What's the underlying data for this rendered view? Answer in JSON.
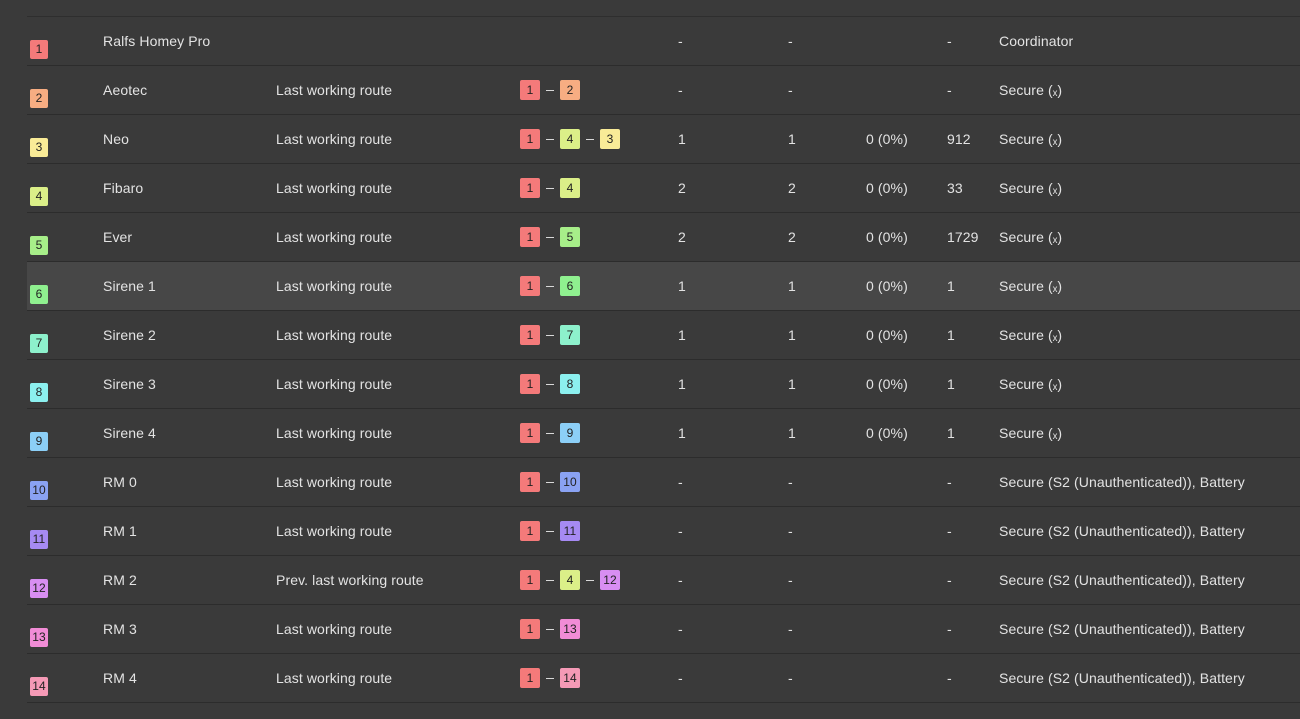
{
  "colors": {
    "1": "#f47a7a",
    "2": "#f7ad82",
    "3": "#f9eb97",
    "4": "#dbef88",
    "5": "#a7ee89",
    "6": "#8ff08f",
    "7": "#8df1cc",
    "8": "#8cf0ef",
    "9": "#8ccff7",
    "10": "#8aa2f2",
    "11": "#a68af3",
    "12": "#d88ef2",
    "13": "#f18cd6",
    "14": "#f59ab6"
  },
  "rows": [
    {
      "id": "1",
      "name": "Ralfs Homey Pro",
      "type": "",
      "route": [],
      "a": "-",
      "b": "-",
      "c": "",
      "d": "-",
      "security": "Coordinator",
      "highlight": false
    },
    {
      "id": "2",
      "name": "Aeotec",
      "type": "Last working route",
      "route": [
        "1",
        "2"
      ],
      "a": "-",
      "b": "-",
      "c": "",
      "d": "-",
      "security": "Secure (ₓ)",
      "highlight": false
    },
    {
      "id": "3",
      "name": "Neo",
      "type": "Last working route",
      "route": [
        "1",
        "4",
        "3"
      ],
      "a": "1",
      "b": "1",
      "c": "0 (0%)",
      "d": "912",
      "security": "Secure (ₓ)",
      "highlight": false
    },
    {
      "id": "4",
      "name": "Fibaro",
      "type": "Last working route",
      "route": [
        "1",
        "4"
      ],
      "a": "2",
      "b": "2",
      "c": "0 (0%)",
      "d": "33",
      "security": "Secure (ₓ)",
      "highlight": false
    },
    {
      "id": "5",
      "name": "Ever",
      "type": "Last working route",
      "route": [
        "1",
        "5"
      ],
      "a": "2",
      "b": "2",
      "c": "0 (0%)",
      "d": "1729",
      "security": "Secure (ₓ)",
      "highlight": false
    },
    {
      "id": "6",
      "name": "Sirene 1",
      "type": "Last working route",
      "route": [
        "1",
        "6"
      ],
      "a": "1",
      "b": "1",
      "c": "0 (0%)",
      "d": "1",
      "security": "Secure (ₓ)",
      "highlight": true
    },
    {
      "id": "7",
      "name": "Sirene 2",
      "type": "Last working route",
      "route": [
        "1",
        "7"
      ],
      "a": "1",
      "b": "1",
      "c": "0 (0%)",
      "d": "1",
      "security": "Secure (ₓ)",
      "highlight": false
    },
    {
      "id": "8",
      "name": "Sirene 3",
      "type": "Last working route",
      "route": [
        "1",
        "8"
      ],
      "a": "1",
      "b": "1",
      "c": "0 (0%)",
      "d": "1",
      "security": "Secure (ₓ)",
      "highlight": false
    },
    {
      "id": "9",
      "name": "Sirene 4",
      "type": "Last working route",
      "route": [
        "1",
        "9"
      ],
      "a": "1",
      "b": "1",
      "c": "0 (0%)",
      "d": "1",
      "security": "Secure (ₓ)",
      "highlight": false
    },
    {
      "id": "10",
      "name": "RM 0",
      "type": "Last working route",
      "route": [
        "1",
        "10"
      ],
      "a": "-",
      "b": "-",
      "c": "",
      "d": "-",
      "security": "Secure (S2 (Unauthenticated)), Battery",
      "highlight": false
    },
    {
      "id": "11",
      "name": "RM 1",
      "type": "Last working route",
      "route": [
        "1",
        "11"
      ],
      "a": "-",
      "b": "-",
      "c": "",
      "d": "-",
      "security": "Secure (S2 (Unauthenticated)), Battery",
      "highlight": false
    },
    {
      "id": "12",
      "name": "RM 2",
      "type": "Prev. last working route",
      "route": [
        "1",
        "4",
        "12"
      ],
      "a": "-",
      "b": "-",
      "c": "",
      "d": "-",
      "security": "Secure (S2 (Unauthenticated)), Battery",
      "highlight": false
    },
    {
      "id": "13",
      "name": "RM 3",
      "type": "Last working route",
      "route": [
        "1",
        "13"
      ],
      "a": "-",
      "b": "-",
      "c": "",
      "d": "-",
      "security": "Secure (S2 (Unauthenticated)), Battery",
      "highlight": false
    },
    {
      "id": "14",
      "name": "RM 4",
      "type": "Last working route",
      "route": [
        "1",
        "14"
      ],
      "a": "-",
      "b": "-",
      "c": "",
      "d": "-",
      "security": "Secure (S2 (Unauthenticated)), Battery",
      "highlight": false
    }
  ]
}
